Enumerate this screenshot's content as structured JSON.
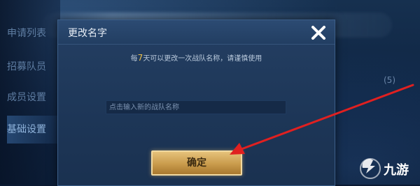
{
  "sidebar": {
    "items": [
      {
        "label": "申请列表",
        "active": false
      },
      {
        "label": "招募队员",
        "active": false
      },
      {
        "label": "成员设置",
        "active": false
      },
      {
        "label": "基础设置",
        "active": true
      }
    ]
  },
  "background_right_text": "(5)",
  "dialog": {
    "title": "更改名字",
    "notice": {
      "prefix": "每",
      "number": "7",
      "suffix": "天可以更改一次战队名称，请谨慎使用"
    },
    "input": {
      "value": "",
      "placeholder": "点击输入新的战队名称"
    },
    "confirm_label": "确定"
  },
  "watermark": {
    "text": "九游"
  },
  "colors": {
    "accent_gold": "#f0c24a",
    "arrow_red": "#e02020",
    "dialog_bg": "#1d3657",
    "button_gold": "#c99b4c"
  },
  "icons": {
    "close": "close-icon",
    "arrow": "red-arrow-annotation",
    "logo": "jiuyou-logo-icon"
  }
}
